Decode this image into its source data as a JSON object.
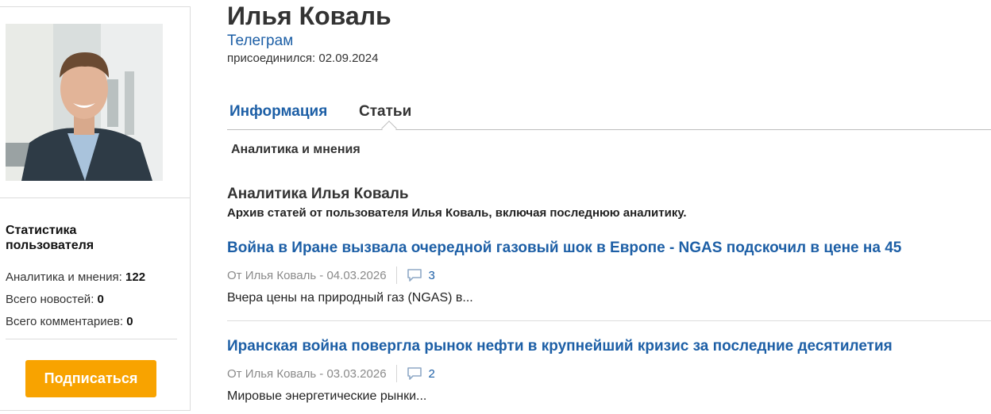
{
  "profile": {
    "name": "Илья Коваль",
    "telegram_label": "Телеграм",
    "joined": "присоединился: 02.09.2024",
    "avatar_alt": "Фото пользователя"
  },
  "stats": {
    "title": "Статистика пользователя",
    "rows": [
      {
        "label": "Аналитика и мнения: ",
        "value": "122"
      },
      {
        "label": "Всего новостей: ",
        "value": "0"
      },
      {
        "label": "Всего комментариев: ",
        "value": "0"
      }
    ],
    "subscribe_label": "Подписаться"
  },
  "tabs": [
    {
      "label": "Информация",
      "active": false
    },
    {
      "label": "Статьи",
      "active": true
    }
  ],
  "subtab": "Аналитика и мнения",
  "section": {
    "title": "Аналитика Илья Коваль",
    "description": "Архив статей от пользователя Илья Коваль, включая последнюю аналитику."
  },
  "articles": [
    {
      "title": "Война в Иране вызвала очередной газовый шок в Европе - NGAS подскочил в цене на 45",
      "meta": "От Илья Коваль - 04.03.2026",
      "comments": "3",
      "snippet": "Вчера цены на природный газ (NGAS) в..."
    },
    {
      "title": "Иранская война повергла рынок нефти в крупнейший кризис за последние десятилетия",
      "meta": "От Илья Коваль - 03.03.2026",
      "comments": "2",
      "snippet": "Мировые энергетические рынки..."
    }
  ],
  "colors": {
    "link": "#1d5fa6",
    "accent_button": "#f8a300",
    "muted_text": "#8a8a8a"
  },
  "icons": {
    "comment": "comment-bubble-icon"
  }
}
